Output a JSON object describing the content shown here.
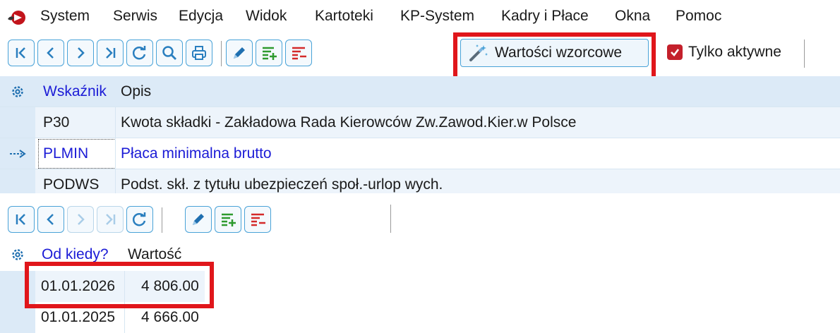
{
  "menu": {
    "items": [
      "System",
      "Serwis",
      "Edycja",
      "Widok",
      "Kartoteki",
      "KP-System",
      "Kadry i Płace",
      "Okna",
      "Pomoc"
    ]
  },
  "toolbar_top": {
    "standard_values_label": "Wartości wzorcowe",
    "active_only_label": "Tylko aktywne",
    "active_only_checked": true
  },
  "top_grid": {
    "columns": [
      "Wskaźnik",
      "Opis"
    ],
    "rows": [
      {
        "code": "P30",
        "description": "Kwota składki - Zakładowa Rada Kierowców Zw.Zawod.Kier.w Polsce",
        "current": false
      },
      {
        "code": "PLMIN",
        "description": "Płaca minimalna brutto",
        "current": true
      },
      {
        "code": "PODWS",
        "description": "Podst. skł. z tytułu ubezpieczeń społ.-urlop wych.",
        "current": false
      }
    ]
  },
  "bottom_grid": {
    "columns": [
      "Od kiedy?",
      "Wartość"
    ],
    "rows": [
      {
        "date": "01.01.2026",
        "value": "4 806.00"
      },
      {
        "date": "01.01.2025",
        "value": "4 666.00"
      }
    ]
  },
  "colors": {
    "accent": "#4aa3d8",
    "highlight": "#e0161b",
    "link_blue": "#1b1bd6",
    "header_bg": "#dceaf7",
    "add_green": "#2e9a2e",
    "remove_red": "#d42a2a"
  }
}
